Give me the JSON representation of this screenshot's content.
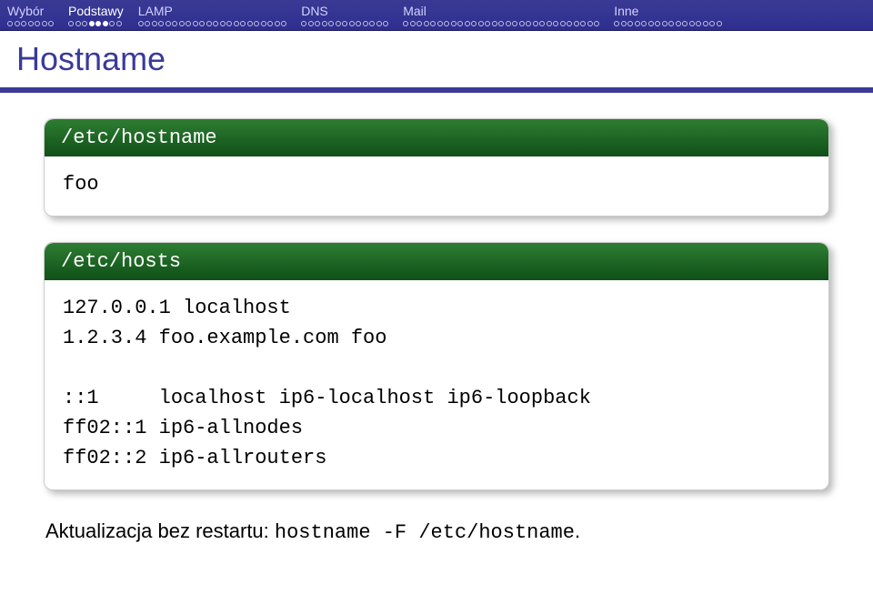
{
  "nav": {
    "sections": [
      {
        "label": "Wybór",
        "total": 7,
        "filled": [],
        "active": false
      },
      {
        "label": "Podstawy",
        "total": 8,
        "filled": [
          3,
          4,
          5
        ],
        "active": true
      },
      {
        "label": "LAMP",
        "total": 22,
        "filled": [],
        "active": false
      },
      {
        "label": "DNS",
        "total": 13,
        "filled": [],
        "active": false
      },
      {
        "label": "Mail",
        "total": 29,
        "filled": [],
        "active": false
      },
      {
        "label": "Inne",
        "total": 16,
        "filled": [],
        "active": false
      }
    ]
  },
  "title": "Hostname",
  "block1": {
    "header": "/etc/hostname",
    "body": "foo"
  },
  "block2": {
    "header": "/etc/hosts",
    "body": "127.0.0.1 localhost\n1.2.3.4 foo.example.com foo\n\n::1     localhost ip6-localhost ip6-loopback\nff02::1 ip6-allnodes\nff02::2 ip6-allrouters"
  },
  "footer": {
    "prefix": "Aktualizacja bez restartu: ",
    "cmd": "hostname -F /etc/hostname",
    "suffix": "."
  }
}
